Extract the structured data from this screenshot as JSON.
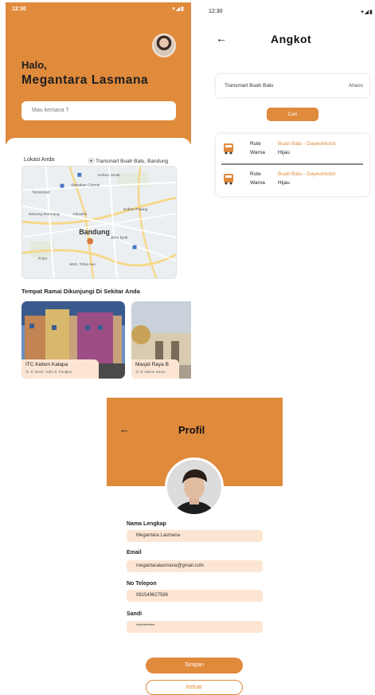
{
  "colors": {
    "accent": "#E08A3C",
    "field_bg": "#FCE6D3",
    "text": "#222222"
  },
  "home": {
    "status": {
      "time": "12:30",
      "icons": [
        "wifi-icon",
        "signal-icon",
        "battery-icon"
      ]
    },
    "greeting": "Halo,",
    "user_name": "Megantara Lasmana",
    "search": {
      "placeholder": "Mau kemana ?"
    },
    "location": {
      "label": "Lokasi Anda",
      "value": "Transmart Buah Batu, Bandung"
    },
    "map": {
      "city_label": "Bandung",
      "place_labels": [
        "Tamansari",
        "Babakan Ciamis",
        "Kebon Jeruk",
        "Cikudek",
        "Kebon Pisang",
        "Warung Muncang",
        "Kopo",
        "Jikre Belti",
        "Kebon Kelapa",
        "Pasir Koja",
        "Moh. Toha Ave"
      ]
    },
    "section_title": "Tempat Ramai Dikunjungi Di Sekitar Anda",
    "places": [
      {
        "name": "ITC Kebon Kalapa",
        "address": "Jl. Moch. Toha Jl. Pungkur"
      },
      {
        "name": "Masjid Raya B",
        "address": "Jl. Dalem Kaum"
      }
    ]
  },
  "angkot": {
    "status": {
      "time": "12:30",
      "icons": [
        "wifi-icon",
        "signal-icon",
        "battery-icon"
      ]
    },
    "title": "Angkot",
    "route": {
      "from": "Transmart Buah Batu",
      "to": "Ahass"
    },
    "search_button": "Cari",
    "results": [
      {
        "route_label": "Rute",
        "route": "Buah Batu - Dayeuhkolot",
        "color_label": "Warna",
        "color": "Hijau"
      },
      {
        "route_label": "Rute",
        "route": "Buah Batu - Dayeuhkolot",
        "color_label": "Warna",
        "color": "Hijau"
      }
    ]
  },
  "profil": {
    "title": "Profil",
    "fields": [
      {
        "label": "Nama Lengkap",
        "value": "Megantara Lasmana"
      },
      {
        "label": "Email",
        "value": "megantaralasmana@gmail.com"
      },
      {
        "label": "No Telepon",
        "value": "081549627586"
      },
      {
        "label": "Sandi",
        "value": "**********"
      }
    ],
    "save_button": "Simpan",
    "logout_button": "Keluar"
  }
}
